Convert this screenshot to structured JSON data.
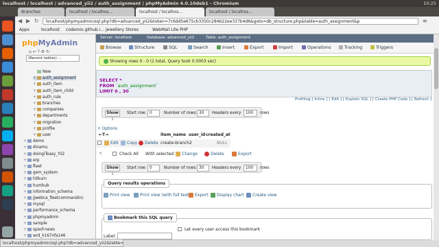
{
  "os": {
    "title": "localhost / localhost / advanced_yii2 / auth_assignment | phpMyAdmin 4.0.10deb1 - Chromium",
    "time": "10:25"
  },
  "browser": {
    "tabs": [
      "Branches",
      "localhost / localhos…",
      "localhost / localhos…",
      "localhost / localhos…"
    ],
    "url": "localhost/phpmyadmin/sql.php?db=advanced_yii2&token=7c6dd5e675cb3350c284b22ee337b4d6&goto=db_structure.php&table=auth_assignment&p",
    "bookmarks": [
      "Apps",
      "localhost",
      "codemix.github.i...",
      "Jewellery Stores",
      "WebMail Lite PHP"
    ]
  },
  "sidebar": {
    "logo_php": "php",
    "logo_my": "MyAdmin",
    "recent": "(Recent tables) ...",
    "tables": [
      "New",
      "auth_assignment",
      "auth_item",
      "auth_item_child",
      "auth_rule",
      "branches",
      "companies",
      "departments",
      "migration",
      "profile",
      "user"
    ],
    "databases": [
      "demo",
      "dinamu",
      "doingiTeasy_Yii2",
      "erp",
      "fleet",
      "gem_system",
      "hilburn",
      "humhub",
      "information_schema",
      "jjwebca_fleetcommandinc",
      "mysql",
      "performance_schema",
      "phpmyadmin",
      "sample",
      "spoof-news",
      "wrd_k167nfa146",
      "yii-group"
    ]
  },
  "crumb": {
    "server": "Server: localhost",
    "database": "Database: advanced_yii2",
    "table": "Table: auth_assignment"
  },
  "menu": [
    "Browse",
    "Structure",
    "SQL",
    "Search",
    "Insert",
    "Export",
    "Import",
    "Operations",
    "Tracking",
    "Triggers"
  ],
  "success": "Showing rows 0 - 0 (1 total, Query took 0.0003 sec)",
  "sql": {
    "select": "SELECT *",
    "from_kw": "FROM",
    "from_tbl": "`auth_assignment`",
    "limit": "LIMIT 0 , 30"
  },
  "sql_links": "Profiling [ Inline ] [ Edit ] [ Explain SQL ] [ Create PHP Code ] [ Refresh ]",
  "showbar": {
    "button": "Show :",
    "start_label": "Start row:",
    "start_val": "0",
    "rows_label": "Number of rows:",
    "rows_val": "30",
    "headers_label": "Headers every",
    "headers_val": "100",
    "rows_suffix": "rows"
  },
  "options": "+ Options",
  "table": {
    "arrows": "←T→",
    "headers": [
      "item_name",
      "user_id",
      "created_at"
    ],
    "row": {
      "edit": "Edit",
      "copy": "Copy",
      "delete": "Delete",
      "item_name": "create-branch",
      "user_id": "2",
      "created_at": "NULL"
    }
  },
  "bulk": {
    "check_all": "Check All",
    "with_selected": "With selected:",
    "change": "Change",
    "delete": "Delete",
    "export": "Export"
  },
  "query_ops": {
    "legend": "Query results operations",
    "print": "Print view",
    "print_full": "Print view (with full texts)",
    "export": "Export",
    "chart": "Display chart",
    "view": "Create view"
  },
  "bookmark": {
    "legend": "Bookmark this SQL query",
    "label": "Label:",
    "every_user": "Let every user access this bookmark"
  },
  "status": "localhost/phpmyadmin/sql.php?db=advanced_yii2&table=aut...",
  "colors": {
    "success_bg": "#ebf8a4",
    "crumb_bg": "#5b6e84",
    "link": "#235a81",
    "delete_red": "#cc3333"
  }
}
